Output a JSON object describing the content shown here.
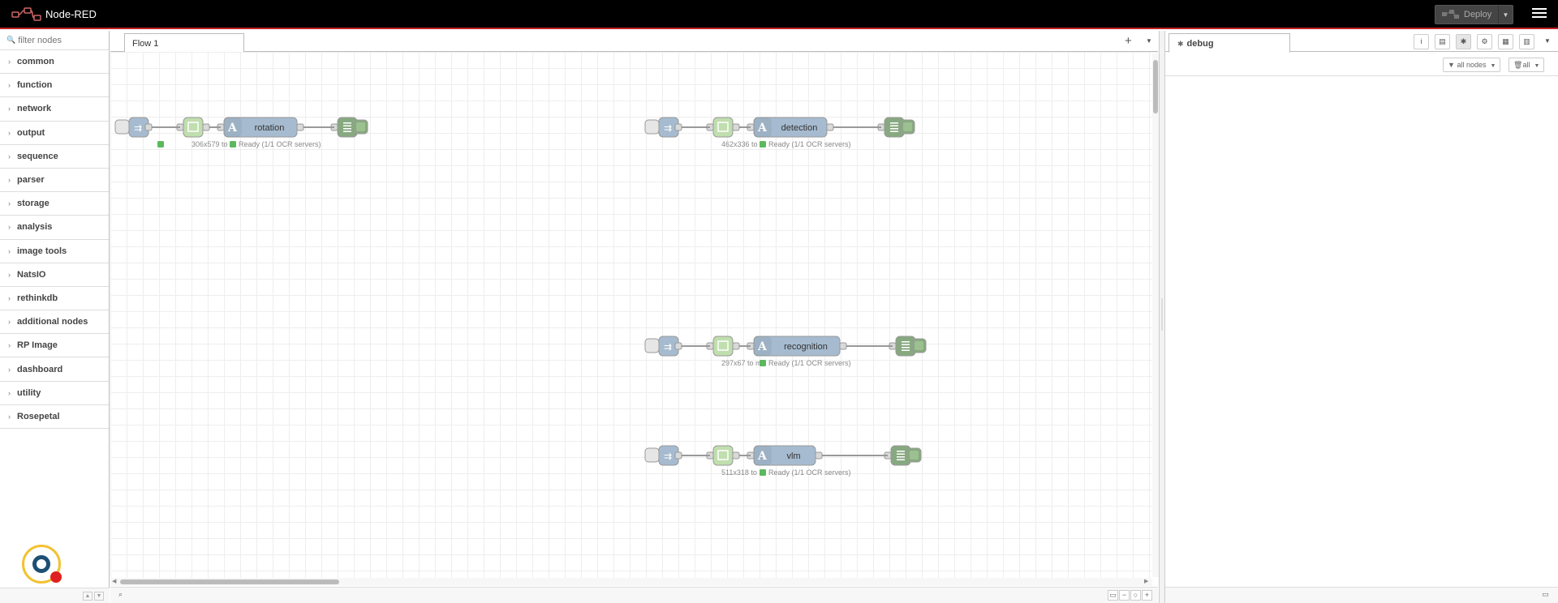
{
  "header": {
    "title": "Node-RED",
    "deploy_label": "Deploy"
  },
  "palette": {
    "search_placeholder": "filter nodes",
    "categories": [
      "common",
      "function",
      "network",
      "output",
      "sequence",
      "parser",
      "storage",
      "analysis",
      "image tools",
      "NatsIO",
      "rethinkdb",
      "additional nodes",
      "RP Image",
      "dashboard",
      "utility",
      "Rosepetal"
    ]
  },
  "workspace": {
    "tab_label": "Flow 1",
    "flows": [
      {
        "ocr_label": "rotation",
        "img_status": "306x579 to",
        "ocr_status": "Ready (1/1 OCR servers)"
      },
      {
        "ocr_label": "detection",
        "img_status": "462x336 to",
        "ocr_status": "Ready (1/1 OCR servers)"
      },
      {
        "ocr_label": "recognition",
        "img_status": "297x67 to m",
        "ocr_status": "Ready (1/1 OCR servers)"
      },
      {
        "ocr_label": "vlm",
        "img_status": "511x318 to m",
        "ocr_status": "Ready (1/1 OCR servers)"
      }
    ]
  },
  "sidebar": {
    "tab_label": "debug",
    "filter_nodes_label": "all nodes",
    "clear_label": "all"
  },
  "colors": {
    "header_bg": "#000000",
    "header_accent": "#c02020",
    "inject_node": "#a6bbcf",
    "image_node": "#c0deae",
    "debug_node": "#87a980",
    "status_green": "#5cb85c"
  }
}
